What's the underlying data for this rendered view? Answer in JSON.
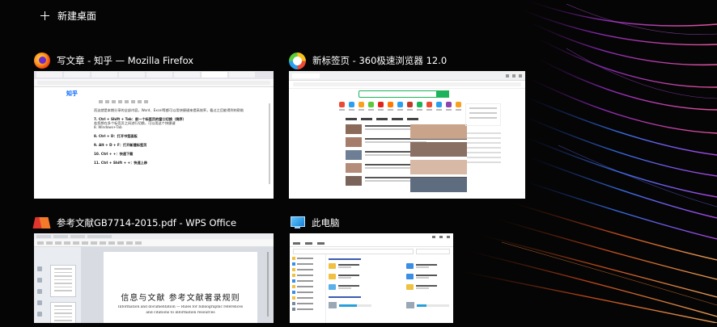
{
  "new_desktop": {
    "label": "新建桌面"
  },
  "windows": [
    {
      "id": "firefox",
      "title": "写文章 - 知乎 — Mozilla Firefox",
      "icon": "firefox-icon",
      "page": {
        "logo": "知乎",
        "lines": [
          {
            "text": "而这就是本期分享的全部内容，Word、Excel等都可以用快捷键来提高效率，看过之后能得到的帮助",
            "heading": false
          },
          {
            "text": "7. Ctrl + Shift + Tab：前一个标签页的窗口切换（倒序）",
            "heading": true
          },
          {
            "text": "若您想在多个标签页之间进行切换，可以用这个快捷键",
            "heading": false
          },
          {
            "text": "8. Windows+Tab",
            "heading": false
          },
          {
            "text": "8. Ctrl + D：打开书签面板",
            "heading": true
          },
          {
            "text": "9. Alt + D + F：打开新建标签页",
            "heading": true
          },
          {
            "text": "10. Ctrl + +：快速下载",
            "heading": true
          },
          {
            "text": "11. Ctrl + Shift + +：快速上移",
            "heading": true
          }
        ]
      }
    },
    {
      "id": "browser360",
      "title": "新标签页 - 360极速浏览器 12.0",
      "icon": "360-browser-icon"
    },
    {
      "id": "wps",
      "title": "参考文献GB7714-2015.pdf - WPS Office",
      "icon": "wps-icon",
      "page": {
        "doc_title": "信息与文献    参考文献著录规则",
        "en_lines": [
          "Information and documentation — Rules for bibliographic references",
          "and citations to information resources"
        ]
      }
    },
    {
      "id": "explorer",
      "title": "此电脑",
      "icon": "this-pc-icon",
      "drives": [
        {
          "usage": 0.55
        },
        {
          "usage": 0.3
        }
      ]
    }
  ],
  "colors": {
    "background": "#050505",
    "zhihu_blue": "#0066ff",
    "green_360": "#1db35a",
    "wps_red": "#e0362e"
  }
}
